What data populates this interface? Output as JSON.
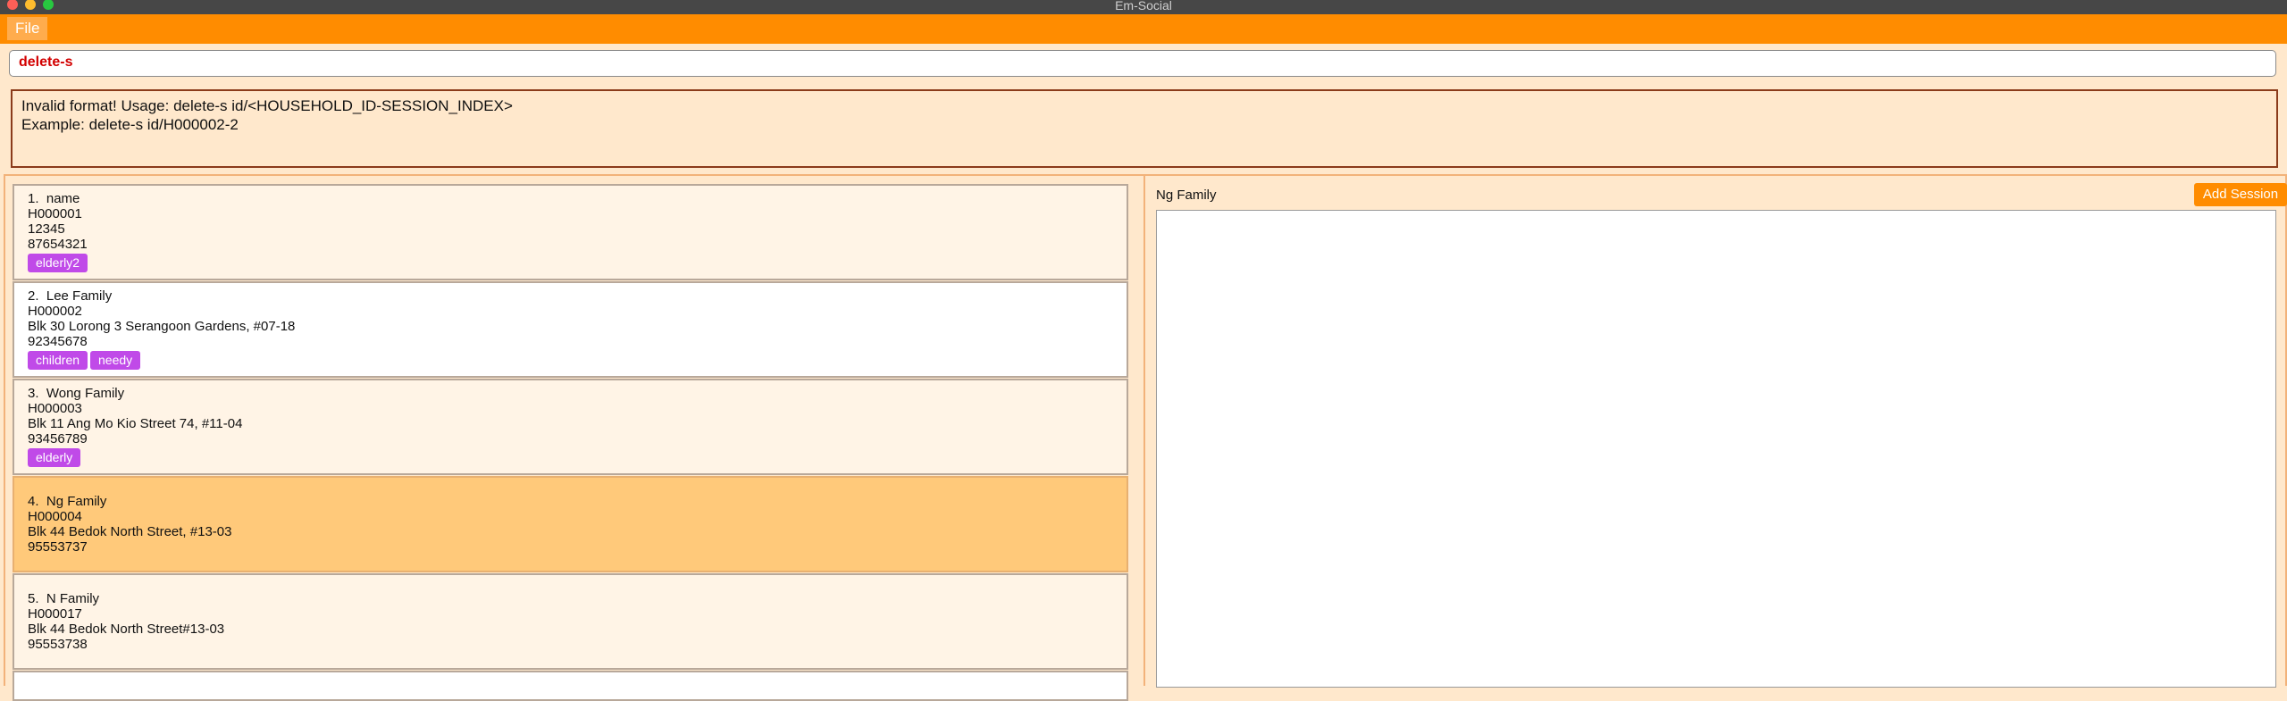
{
  "window": {
    "title": "Em-Social"
  },
  "menu": {
    "file": "File"
  },
  "command": {
    "value": "delete-s"
  },
  "result": {
    "line1": "Invalid format! Usage: delete-s id/<HOUSEHOLD_ID-SESSION_INDEX>",
    "line2": "Example: delete-s id/H000002-2"
  },
  "households": [
    {
      "index": "1.",
      "name": "name",
      "id": "H000001",
      "address": "12345",
      "phone": "87654321",
      "tags": [
        "elderly2"
      ]
    },
    {
      "index": "2.",
      "name": "Lee Family",
      "id": "H000002",
      "address": "Blk 30 Lorong 3 Serangoon Gardens, #07-18",
      "phone": "92345678",
      "tags": [
        "children",
        "needy"
      ]
    },
    {
      "index": "3.",
      "name": "Wong Family",
      "id": "H000003",
      "address": "Blk 11 Ang Mo Kio Street 74, #11-04",
      "phone": "93456789",
      "tags": [
        "elderly"
      ]
    },
    {
      "index": "4.",
      "name": "Ng Family",
      "id": "H000004",
      "address": "Blk 44 Bedok North Street, #13-03",
      "phone": "95553737",
      "tags": []
    },
    {
      "index": "5.",
      "name": "N Family",
      "id": "H000017",
      "address": "Blk 44 Bedok North Street#13-03",
      "phone": "95553738",
      "tags": []
    }
  ],
  "detail": {
    "title": "Ng Family",
    "add_session_label": "Add Session"
  },
  "colors": {
    "accent": "#ff8c00",
    "tag": "#c04ae8",
    "selected": "#ffc97a",
    "card": "#fff4e6",
    "error": "#d20000"
  }
}
